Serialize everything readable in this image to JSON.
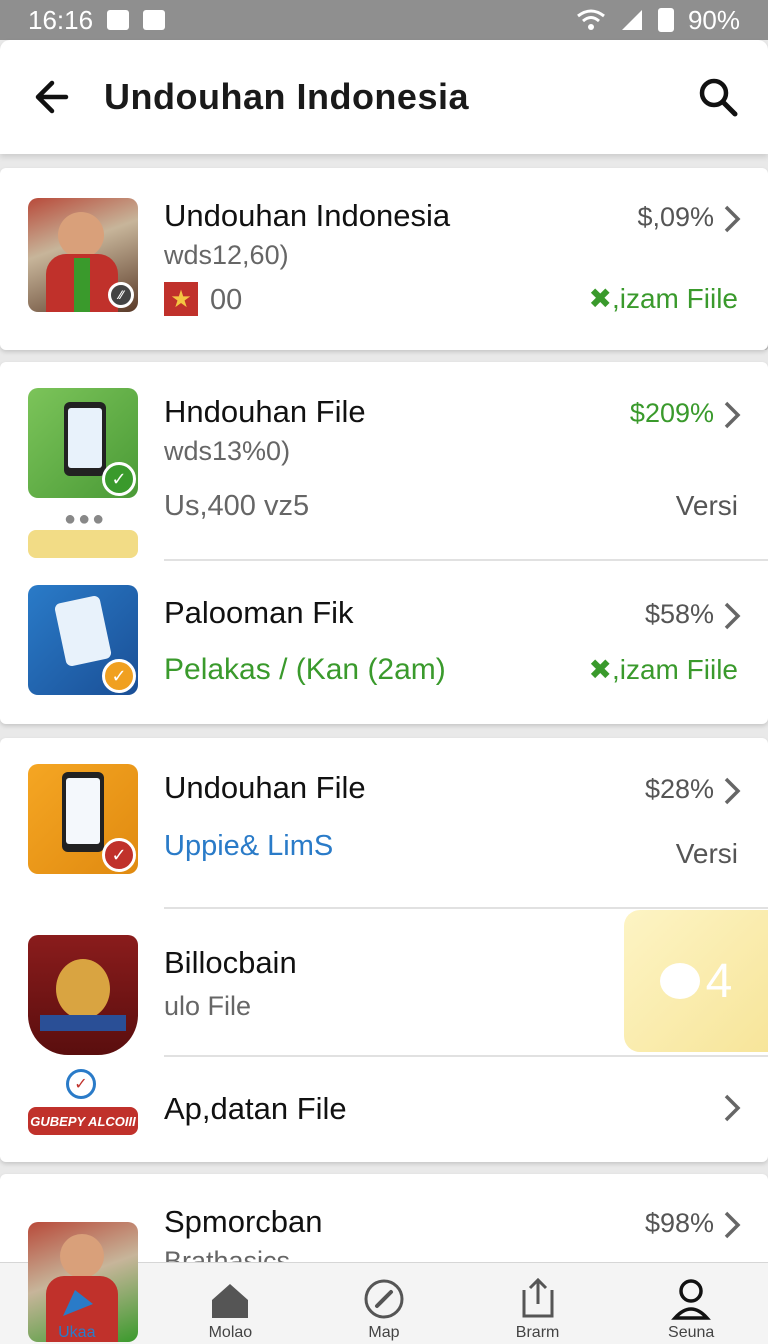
{
  "status_bar": {
    "time": "16:16",
    "battery": "90%"
  },
  "header": {
    "title": "Undouhan Indonesia"
  },
  "items": [
    {
      "title": "Undouhan Indonesia",
      "subtitle": "wds12,60)",
      "extra": "00",
      "percent": "$,09%",
      "right_label": "✖,izam Fiile"
    },
    {
      "title": "Hndouhan File",
      "subtitle": "wds13%0)",
      "extra": "Us,400 vz5",
      "percent": "$209%",
      "right_label": "Versi"
    },
    {
      "title": "Palooman Fik",
      "subtitle": "Pelakas / (Kan (2am)",
      "percent": "$58%",
      "right_label": "✖,izam Fiile"
    },
    {
      "title": "Undouhan File",
      "subtitle": "Uppie& LimS",
      "percent": "$28%",
      "right_label": "Versi"
    },
    {
      "title": "Billocbain",
      "subtitle": "ulo File",
      "badge_value": "4",
      "logo_text": "GUBEPY ALCOIII"
    },
    {
      "title": "Ap,datan File"
    },
    {
      "title": "Spmorcban",
      "subtitle": "Brathasics",
      "percent": "$98%"
    }
  ],
  "bottom_nav": [
    {
      "label": "Ukaa",
      "icon": "flag-icon",
      "active": true
    },
    {
      "label": "Molao",
      "icon": "home-icon",
      "active": false
    },
    {
      "label": "Map",
      "icon": "compass-icon",
      "active": false
    },
    {
      "label": "Brarm",
      "icon": "share-icon",
      "active": false
    },
    {
      "label": "Seuna",
      "icon": "person-icon",
      "active": false
    }
  ],
  "colors": {
    "accent_green": "#3a9a2c",
    "accent_blue": "#2a7bc8",
    "status_bar": "#8f8f8f"
  }
}
